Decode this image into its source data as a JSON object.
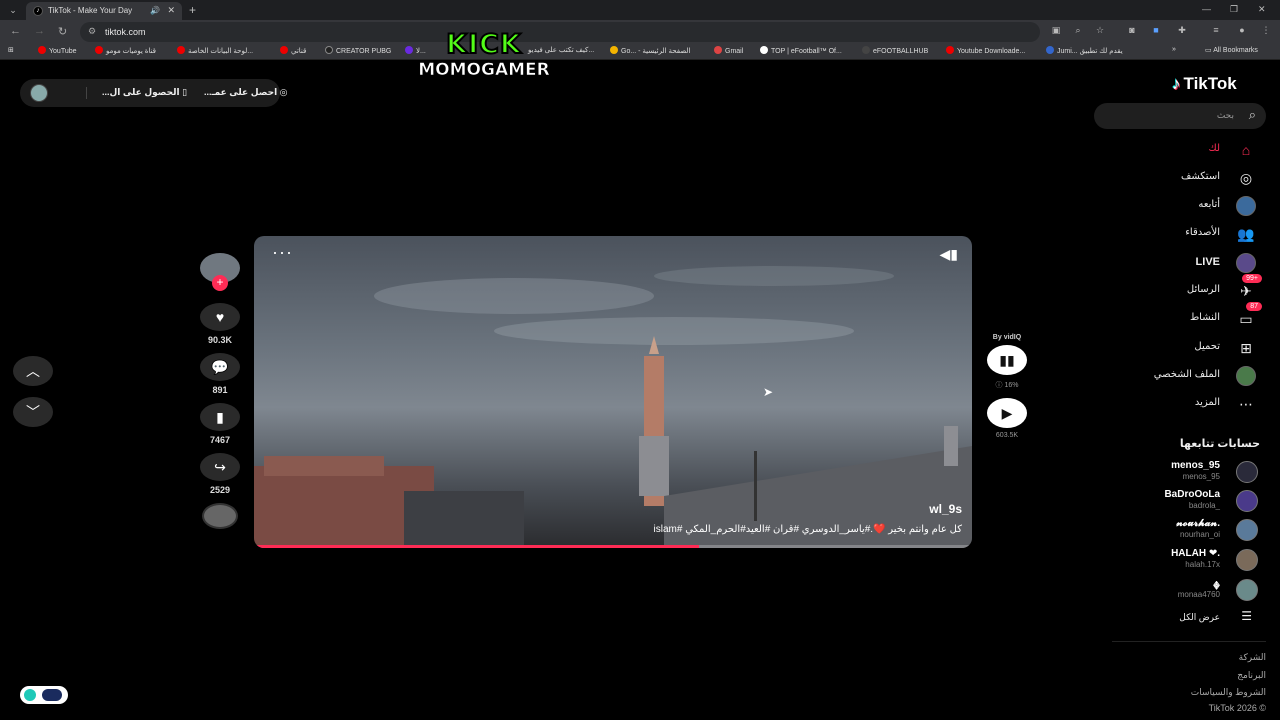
{
  "browser": {
    "tab_title": "TikTok - Make Your Day",
    "url": "tiktok.com",
    "bookmarks": [
      "YouTube",
      "قناة يوميات مومو",
      "لوحة البيانات الخاصة...",
      "قناتي",
      "CREATOR PUBG",
      "لا...",
      "كيف تكتب على فيديو...",
      "Go... - الصفحة الرئيسية",
      "Gmail",
      "TOP | eFootball™ Of...",
      "eFOOTBALLHUB",
      "Youtube Downloade...",
      "Jumi... يقدم لك تطبيق",
      "All Bookmarks"
    ]
  },
  "overlay": {
    "line1": "KICK",
    "line2": "MOMOGAMER"
  },
  "top_pill": {
    "item1": "احصل على عمـ...",
    "item2": "الحصول على ال..."
  },
  "logo": "TikTok",
  "search": {
    "placeholder": "بحث"
  },
  "nav": [
    {
      "label": "لك",
      "icon": "home-icon",
      "active": true
    },
    {
      "label": "استكشف",
      "icon": "compass-icon"
    },
    {
      "label": "أتابعه",
      "icon": "following-avatar-icon"
    },
    {
      "label": "الأصدقاء",
      "icon": "friends-icon"
    },
    {
      "label": "LIVE",
      "icon": "live-icon"
    },
    {
      "label": "الرسائل",
      "icon": "messages-icon",
      "badge": "99+"
    },
    {
      "label": "النشاط",
      "icon": "activity-icon",
      "badge": "87"
    },
    {
      "label": "تحميل",
      "icon": "upload-icon"
    },
    {
      "label": "الملف الشخصي",
      "icon": "profile-avatar-icon"
    },
    {
      "label": "المزيد",
      "icon": "more-icon"
    }
  ],
  "following": {
    "title": "حسابات تتابعها",
    "accounts": [
      {
        "name": "menos_95",
        "uid": "menos_95"
      },
      {
        "name": "BaDroOoLa",
        "uid": "badrola_"
      },
      {
        "name": "𝓷𝓸𝓾𝓻𝓱𝓪𝓷.",
        "uid": "nourhan_oi"
      },
      {
        "name": "HALAH ❤.",
        "uid": "halah.17x"
      },
      {
        "name": "𖢻",
        "uid": "monaa4760"
      }
    ],
    "show_all": "عرض الكل"
  },
  "footer": [
    "الشركة",
    "البرنامج",
    "الشروط والسياسات",
    "© 2026 TikTok"
  ],
  "video": {
    "author": "wl_9s",
    "caption": "كل عام وانتم بخير ❤️.#ياسر_الدوسري #قران #العيد#الحرم_المكي #islam",
    "progress": 0.62
  },
  "actions": {
    "likes": "90.3K",
    "comments": "891",
    "saves": "7467",
    "shares": "2529"
  },
  "vidiq": {
    "by": "By vidIQ",
    "pct": "16%",
    "views": "603.5K"
  }
}
